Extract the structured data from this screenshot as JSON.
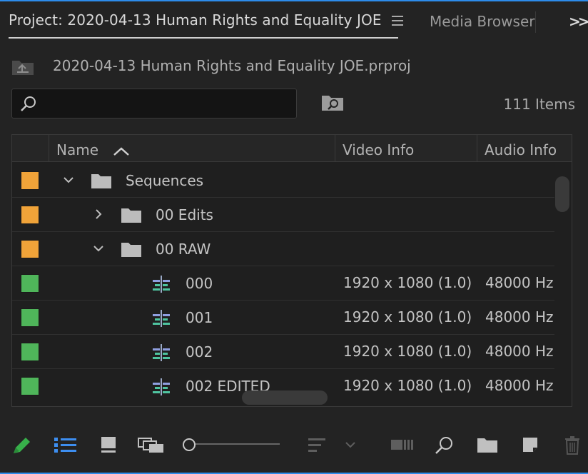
{
  "tabs": {
    "project_label": "Project: 2020-04-13 Human Rights and Equality JOE",
    "media_browser_label": "Media Browser",
    "overflow_label": ">>"
  },
  "project": {
    "filename": "2020-04-13 Human Rights and Equality JOE.prproj"
  },
  "search": {
    "value": "",
    "placeholder": ""
  },
  "item_count": "111 Items",
  "columns": {
    "name": "Name",
    "video_info": "Video Info",
    "audio_info": "Audio Info"
  },
  "rows": [
    {
      "label_color": "#f0a339",
      "type": "folder",
      "expanded": true,
      "name": "Sequences",
      "video": "",
      "audio": ""
    },
    {
      "label_color": "#f0a339",
      "type": "folder",
      "expanded": false,
      "name": "00 Edits",
      "video": "",
      "audio": ""
    },
    {
      "label_color": "#f0a339",
      "type": "folder",
      "expanded": true,
      "name": "00 RAW",
      "video": "",
      "audio": ""
    },
    {
      "label_color": "#4fb55a",
      "type": "sequence",
      "name": "000",
      "video": "1920 x 1080 (1.0)",
      "audio": "48000 Hz"
    },
    {
      "label_color": "#4fb55a",
      "type": "sequence",
      "name": "001",
      "video": "1920 x 1080 (1.0)",
      "audio": "48000 Hz"
    },
    {
      "label_color": "#4fb55a",
      "type": "sequence",
      "name": "002",
      "video": "1920 x 1080 (1.0)",
      "audio": "48000 Hz"
    },
    {
      "label_color": "#4fb55a",
      "type": "sequence",
      "name": "002 EDITED",
      "video": "1920 x 1080 (1.0)",
      "audio": "48000 Hz"
    }
  ],
  "colors": {
    "accent": "#2d8ceb",
    "folder_label": "#f0a339",
    "sequence_label": "#4fb55a",
    "pencil": "#37b04a"
  },
  "toolbar_icons": [
    "pencil-icon",
    "list-view-icon",
    "icon-view-icon",
    "freeform-view-icon",
    "zoom-slider",
    "sort-icon",
    "sort-dropdown-icon",
    "automate-to-sequence-icon",
    "find-icon",
    "new-bin-icon",
    "new-item-icon",
    "trash-icon"
  ]
}
